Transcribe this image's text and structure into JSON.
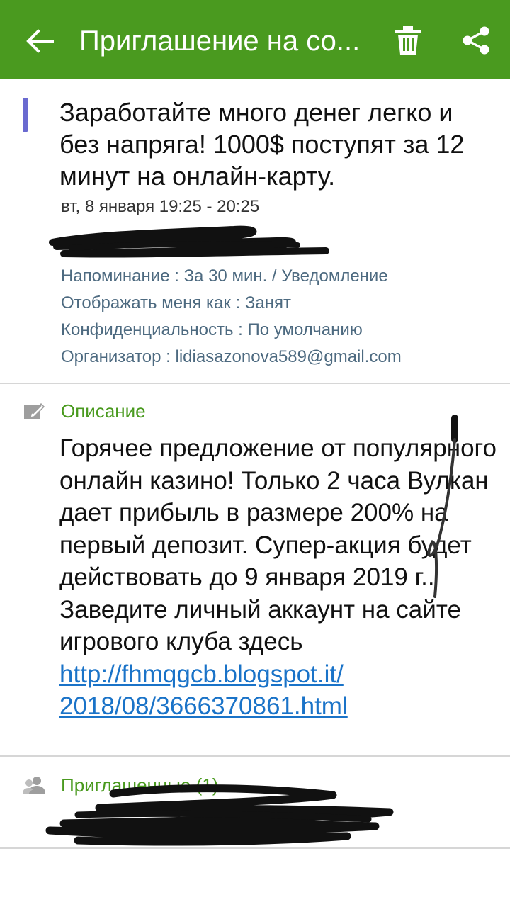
{
  "appbar": {
    "title": "Приглашение на со...",
    "back_icon": "arrow-back-icon",
    "delete_icon": "trash-icon",
    "share_icon": "share-icon",
    "color": "#4a9a1f"
  },
  "event": {
    "title": "Заработайте много денег легко и без напряга! 1000$ поступят за 12 минут на онлайн-карту.",
    "time": "вт, 8 января 19:25 - 20:25",
    "accent_color": "#6a6ad0",
    "details": [
      {
        "label": "Напоминание",
        "value": "За 30 мин. / Уведомление"
      },
      {
        "label": "Отображать меня как",
        "value": "Занят"
      },
      {
        "label": "Конфиденциальность",
        "value": "По умолчанию"
      },
      {
        "label": "Организатор",
        "value": "lidiasazonova589@gmail.com"
      }
    ]
  },
  "description": {
    "label": "Описание",
    "icon": "edit-note-icon",
    "text": "Горячее предложение от популярного онлайн казино! Только 2 часа Вулкан дает прибыль в размере 200% на первый депозит. Супер-акция будет действовать до 9 января 2019 г.. Заведите личный аккаунт на сайте игрового клуба здесь",
    "link": "http://fhmqgcb.blogspot.it/\n2018/08/3666370861.html"
  },
  "invitees": {
    "label": "Приглашенные (1)",
    "icon": "people-icon"
  }
}
